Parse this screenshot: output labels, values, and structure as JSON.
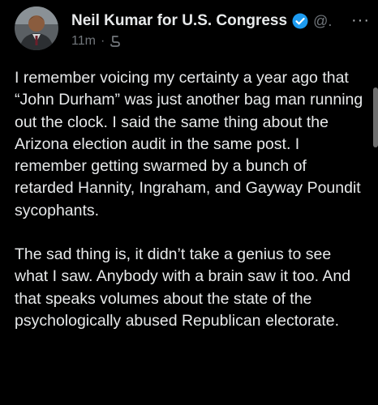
{
  "post": {
    "author_name": "Neil Kumar for U.S. Congress",
    "handle": "@.",
    "time": "11m",
    "separator": "·",
    "more_label": "···",
    "paragraphs": [
      "I remember voicing my certainty a year ago that “John Durham” was just another bag man running out the clock. I said the same thing about the Arizona election audit in the same post. I remember getting swarmed by a bunch of retarded Hannity, Ingraham, and Gayway Poundit sycophants.",
      "The sad thing is, it didn’t take a genius to see what I saw. Anybody with a brain saw it too. And that speaks volumes about the state of the psychologically abused Republican electorate."
    ]
  },
  "colors": {
    "background": "#000000",
    "text": "#e7e9ea",
    "secondary": "#71767b",
    "verified_badge": "#1d9bf0"
  }
}
